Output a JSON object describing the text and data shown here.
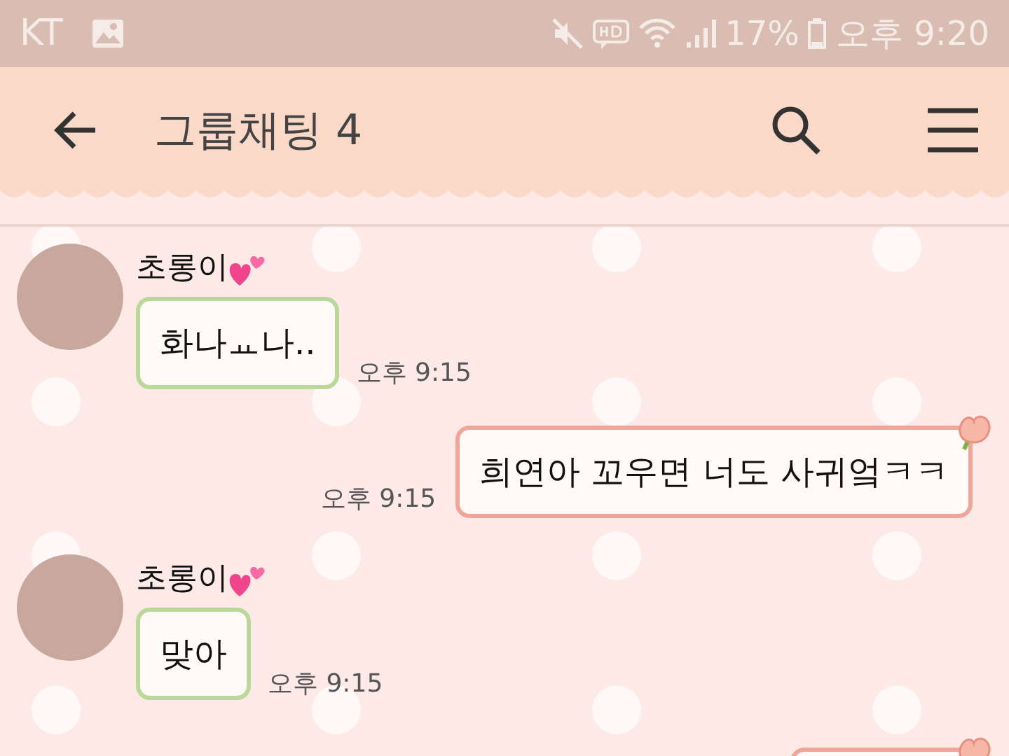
{
  "status_bar": {
    "carrier": "KT",
    "battery_percent": "17%",
    "time": "오후 9:20"
  },
  "header": {
    "title": "그룹채팅 4"
  },
  "messages": [
    {
      "kind": "incoming",
      "sender": "초롱이",
      "text": "화나ㅛ나..",
      "time": "오후 9:15"
    },
    {
      "kind": "outgoing",
      "text": "희연아 꼬우면 너도 사귀엌ㅋㅋ",
      "time": "오후 9:15"
    },
    {
      "kind": "incoming",
      "sender": "초롱이",
      "text": "맞아",
      "time": "오후 9:15"
    },
    {
      "kind": "outgoing"
    }
  ]
}
